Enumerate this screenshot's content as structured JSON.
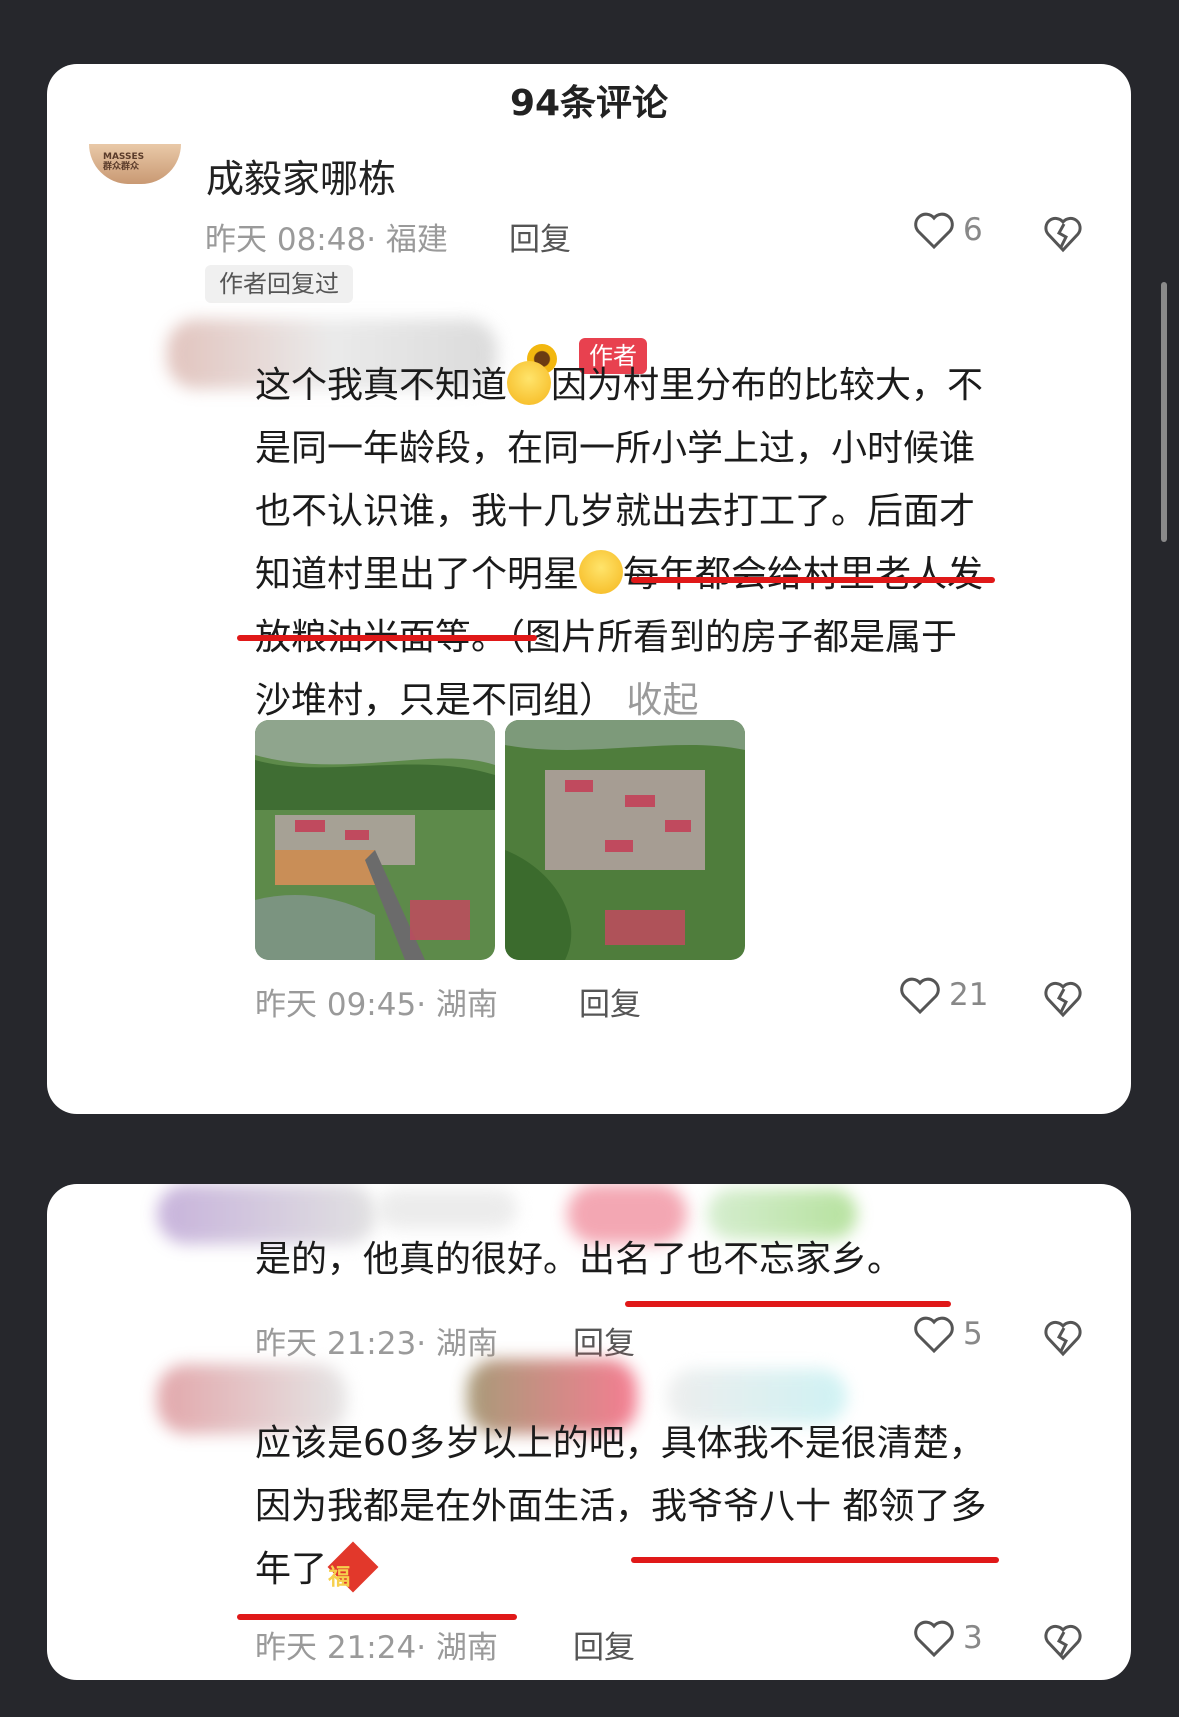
{
  "header": {
    "title": "94条评论"
  },
  "top_comment": {
    "avatar_text": "MASSES\n群众群众",
    "username": "成毅家哪栋",
    "time": "昨天 08:48",
    "location": "福建",
    "reply_label": "回复",
    "likes": "6",
    "author_replied_tag": "作者回复过"
  },
  "author_reply": {
    "badge": "作者",
    "text_line1": "这个我真不知道",
    "text_line1b": "因为村里分布的比较大，不",
    "text_line2": "是同一年龄段，在同一所小学上过，小时候谁",
    "text_line3": "也不认识谁，我十几岁就出去打工了。后面才",
    "text_line4a": "知道村里出了个明星",
    "text_line4b": "每年都会给村里老人发",
    "text_line5a": "放粮油米面等。",
    "text_line5b": "（图片所看到的房子都是属于",
    "text_line6": "沙堆村，只是不同组）",
    "collapse_label": "收起",
    "time": "昨天 09:45",
    "location": "湖南",
    "reply_label": "回复",
    "likes": "21"
  },
  "reply2": {
    "text_a": "是的，他真的很好。",
    "text_b": "出名了也不忘家乡。",
    "time": "昨天 21:23",
    "location": "湖南",
    "reply_label": "回复",
    "likes": "5"
  },
  "reply3": {
    "text_line1": "应该是60多岁以上的吧，具体我不是很清楚，",
    "text_line2a": "因为我都是在外面生活，",
    "text_line2b": "我爷爷八十 都领了多",
    "text_line3": "年了",
    "fu_char": "福",
    "time": "昨天 21:24",
    "location": "湖南",
    "reply_label": "回复",
    "likes": "3"
  },
  "colors": {
    "underline": "#e01818",
    "badge": "#e8414f",
    "background": "#26272c"
  }
}
